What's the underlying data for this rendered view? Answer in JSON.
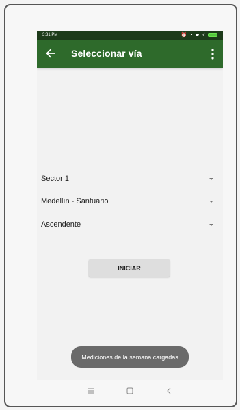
{
  "status_bar": {
    "time": "3:31 PM",
    "icons": [
      "more-dots-icon",
      "alarm-icon",
      "wifi-icon",
      "signal-icon",
      "charging-icon",
      "battery-icon"
    ]
  },
  "app_bar": {
    "title": "Seleccionar vía",
    "back_icon": "arrow-back-icon",
    "menu_icon": "more-vert-icon",
    "color": "#2e6a2b"
  },
  "form": {
    "sector_value": "Sector 1",
    "route_value": "Medellín - Santuario",
    "direction_value": "Ascendente",
    "input_value": "",
    "start_label": "INICIAR"
  },
  "toast": {
    "message": "Mediciones de la semana cargadas"
  },
  "nav_bar": {
    "icons": [
      "menu-icon",
      "home-square-icon",
      "back-chevron-icon"
    ]
  }
}
